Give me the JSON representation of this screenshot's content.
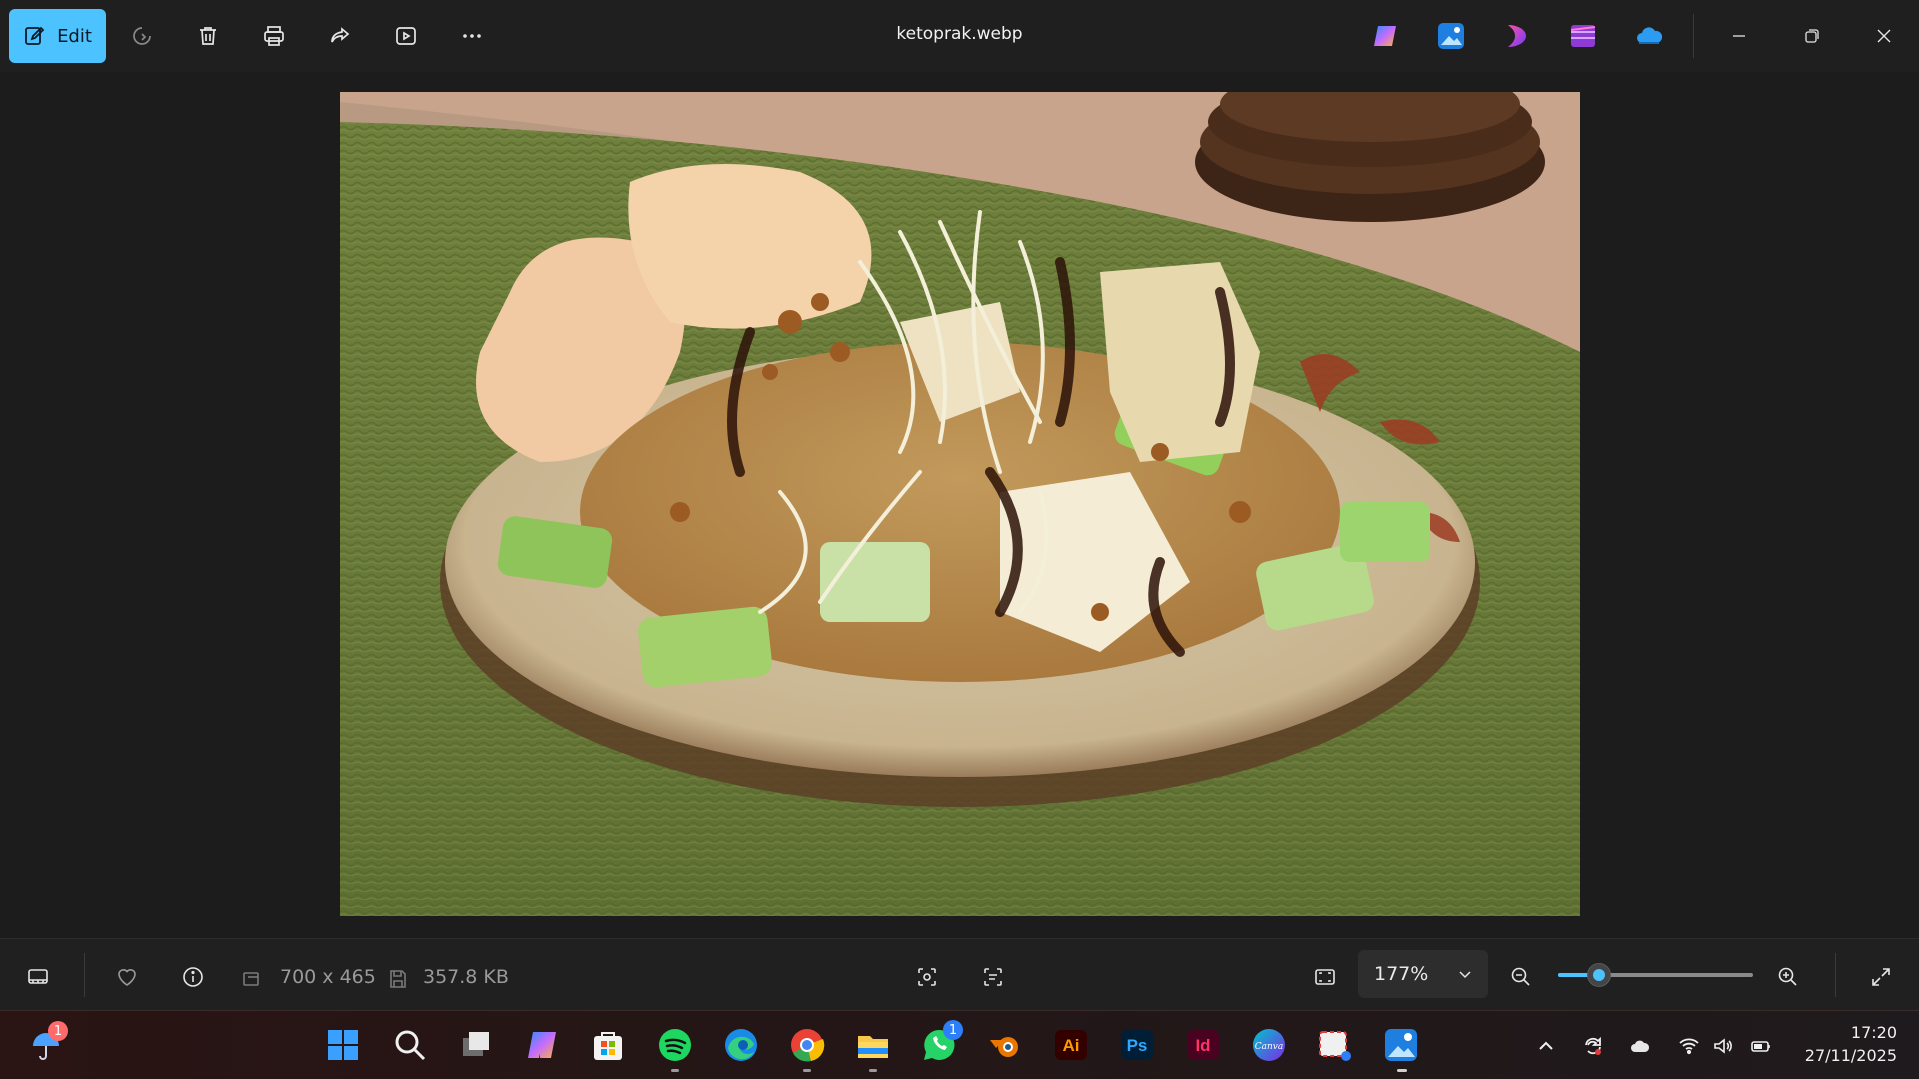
{
  "window": {
    "title": "ketoprak.webp",
    "edit_label": "Edit"
  },
  "toolbar_icons": [
    "edit-icon",
    "rotate-icon",
    "delete-icon",
    "print-icon",
    "share-icon",
    "slideshow-icon",
    "more-icon"
  ],
  "header_apps": [
    "copilot-icon",
    "photos-app-icon",
    "clipchamp-icon",
    "designer-icon",
    "onedrive-icon"
  ],
  "file_info": {
    "dimensions": "700 x 465",
    "size": "357.8 KB"
  },
  "zoom": {
    "label": "177%",
    "slider_level": 0.21
  },
  "taskbar": {
    "weather_badge": "1",
    "whatsapp_badge": "1",
    "apps": [
      "start",
      "search",
      "task-view",
      "copilot",
      "microsoft-store",
      "spotify",
      "edge",
      "chrome",
      "file-explorer",
      "whatsapp",
      "blender",
      "illustrator",
      "photoshop",
      "indesign",
      "canva",
      "snipping-tool",
      "photos"
    ],
    "illustrator_label": "Ai",
    "photoshop_label": "Ps",
    "indesign_label": "Id",
    "canva_label": "Canva"
  },
  "clock": {
    "time": "17:20",
    "date": "27/11/2025"
  },
  "colors": {
    "accent": "#4cc2ff",
    "background": "#1f1f1f"
  }
}
